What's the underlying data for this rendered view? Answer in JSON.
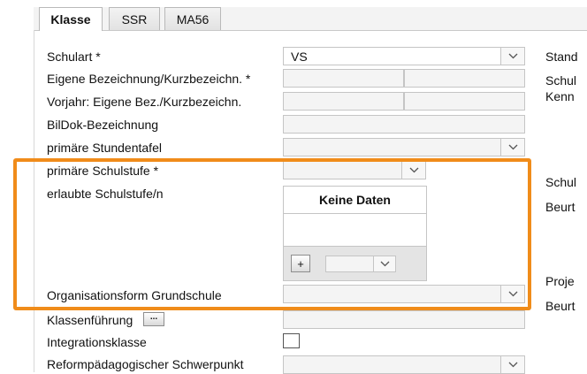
{
  "tabs": [
    {
      "label": "Klasse",
      "active": true
    },
    {
      "label": "SSR",
      "active": false
    },
    {
      "label": "MA56",
      "active": false
    }
  ],
  "form": {
    "schulart_label": "Schulart *",
    "schulart_value": "VS",
    "eigene_bez_label": "Eigene Bezeichnung/Kurzbezeichn. *",
    "vorjahr_label": "Vorjahr: Eigene Bez./Kurzbezeichn.",
    "bildok_label": "BilDok-Bezeichnung",
    "stundentafel_label": "primäre Stundentafel",
    "schulstufe_label": "primäre Schulstufe *",
    "erlaubte_label": "erlaubte Schulstufe/n",
    "grid_empty": "Keine Daten",
    "add_symbol": "+",
    "org_label": "Organisationsform Grundschule",
    "klassenfuehrung_label": "Klassenführung",
    "dots_symbol": "...",
    "integration_label": "Integrationsklasse",
    "reform_label": "Reformpädagogischer Schwerpunkt"
  },
  "right_labels": [
    "Stand",
    "Schul",
    "Kenn",
    "Schul",
    "Beurt",
    "Proje",
    "Beurt"
  ],
  "colors": {
    "highlight": "#f08c1a"
  },
  "icons": {
    "dropdown": "chevron-down-icon"
  }
}
